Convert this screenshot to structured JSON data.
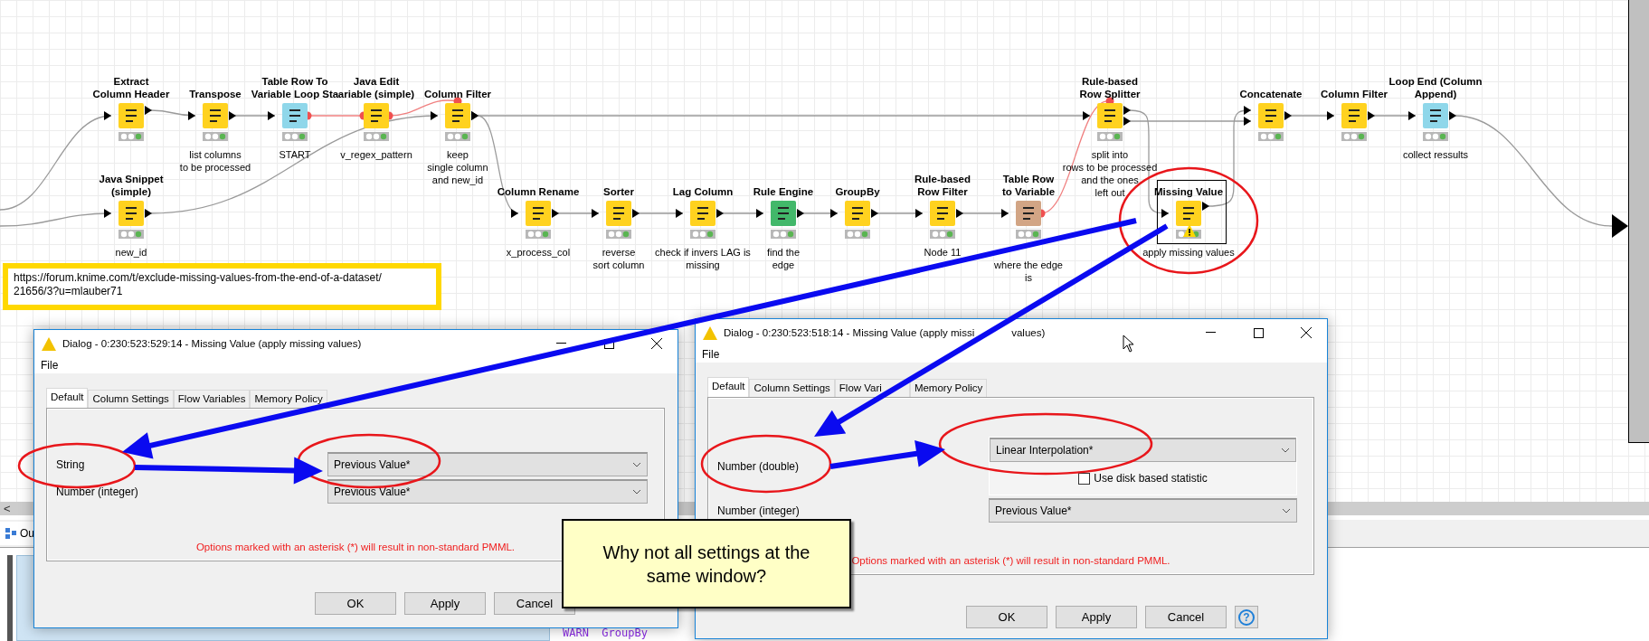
{
  "workflow": {
    "nodes": [
      {
        "title": "Extract\nColumn Header",
        "color": "#ffd21f",
        "selected": false,
        "warning": false
      },
      {
        "title": "Transpose",
        "label": "list columns\nto be processed",
        "color": "#ffd21f",
        "selected": false,
        "warning": false
      },
      {
        "title": "Table Row To\nVariable Loop Sta",
        "label": "START",
        "color": "#8fd7ea",
        "selected": false,
        "warning": false
      },
      {
        "title": "Java Edit\nariable (simple)",
        "label": "v_regex_pattern",
        "color": "#ffd21f",
        "selected": false,
        "warning": false
      },
      {
        "title": "Column Filter",
        "label": "keep\nsingle column\nand new_id",
        "color": "#ffd21f",
        "selected": false,
        "warning": false
      },
      {
        "title": "Java Snippet\n(simple)",
        "label": "new_id",
        "color": "#ffd21f",
        "selected": false,
        "warning": false
      },
      {
        "title": "Column Rename",
        "label": "x_process_col",
        "color": "#ffd21f",
        "selected": false,
        "warning": false
      },
      {
        "title": "Sorter",
        "label": "reverse\nsort column",
        "color": "#ffd21f",
        "selected": false,
        "warning": false
      },
      {
        "title": "Lag Column",
        "label": "check if invers LAG is\nmissing",
        "color": "#ffd21f",
        "selected": false,
        "warning": false
      },
      {
        "title": "Rule Engine",
        "label": "find the\nedge",
        "color": "#42b86a",
        "selected": false,
        "warning": false
      },
      {
        "title": "GroupBy",
        "color": "#ffd21f",
        "selected": false,
        "warning": false
      },
      {
        "title": "Rule-based\nRow Filter",
        "label": "Node 11",
        "color": "#ffd21f",
        "selected": false,
        "warning": false
      },
      {
        "title": "Table Row\nto Variable",
        "label": "where the edge\nis",
        "color": "#d2a585",
        "selected": false,
        "warning": false
      },
      {
        "title": "Rule-based\nRow Splitter",
        "label": "split into\nrows to be processed\nand the ones\nleft out",
        "color": "#ffd21f",
        "selected": false,
        "warning": false
      },
      {
        "title": "Missing Value",
        "label": "apply missing values",
        "color": "#ffd21f",
        "selected": true,
        "warning": true
      },
      {
        "title": "Concatenate",
        "color": "#ffd21f",
        "selected": false,
        "warning": false
      },
      {
        "title": "Column Filter",
        "color": "#ffd21f",
        "selected": false,
        "warning": false
      },
      {
        "title": "Loop End (Column\nAppend)",
        "label": "collect ressults",
        "color": "#8fd7ea",
        "selected": false,
        "warning": false
      }
    ],
    "note": "https://forum.knime.com/t/exclude-missing-values-from-the-end-of-a-dataset/\n21656/3?u=mlauber71"
  },
  "bottom_panel": {
    "scroll_left": "<",
    "tab": "Ou",
    "console": [
      {
        "level": "WARN",
        "text": "GroupBy"
      }
    ]
  },
  "dialogs": [
    {
      "title": "Dialog - 0:230:523:529:14 - Missing Value (apply missing values)",
      "menu": [
        "File"
      ],
      "tabs": [
        {
          "label": "Default",
          "selected": true
        },
        {
          "label": "Column Settings",
          "selected": false
        },
        {
          "label": "Flow Variables",
          "selected": false
        },
        {
          "label": "Memory Policy",
          "selected": false
        }
      ],
      "options": [
        {
          "kind": "dropdown",
          "label": "String",
          "value": "Previous Value*"
        },
        {
          "kind": "dropdown",
          "label": "Number (integer)",
          "value": "Previous Value*"
        }
      ],
      "note": "Options marked with an asterisk (*) will result in non-standard PMML.",
      "buttons": [
        "OK",
        "Apply",
        "Cancel"
      ]
    },
    {
      "title": "Dialog - 0:230:523:518:14 - Missing Value (apply missi",
      "title_tail": "values)",
      "menu": [
        "File"
      ],
      "tabs": [
        {
          "label": "Default",
          "selected": true
        },
        {
          "label": "Column Settings",
          "selected": false
        },
        {
          "label": "Flow Vari",
          "selected": false
        },
        {
          "label": "Memory Policy",
          "selected": false
        }
      ],
      "options": [
        {
          "kind": "dropdown_with_checkbox",
          "label": "Number (double)",
          "value": "Linear Interpolation*",
          "checkbox": {
            "label": "Use disk based statistic",
            "checked": false
          }
        },
        {
          "kind": "dropdown",
          "label": "Number (integer)",
          "value": "Previous Value*"
        }
      ],
      "note": "Options marked with an asterisk (*) will result in non-standard PMML.",
      "buttons": [
        "OK",
        "Apply",
        "Cancel"
      ],
      "help_button": "?"
    }
  ],
  "callout": {
    "text": "Why not all settings at the same window?"
  }
}
